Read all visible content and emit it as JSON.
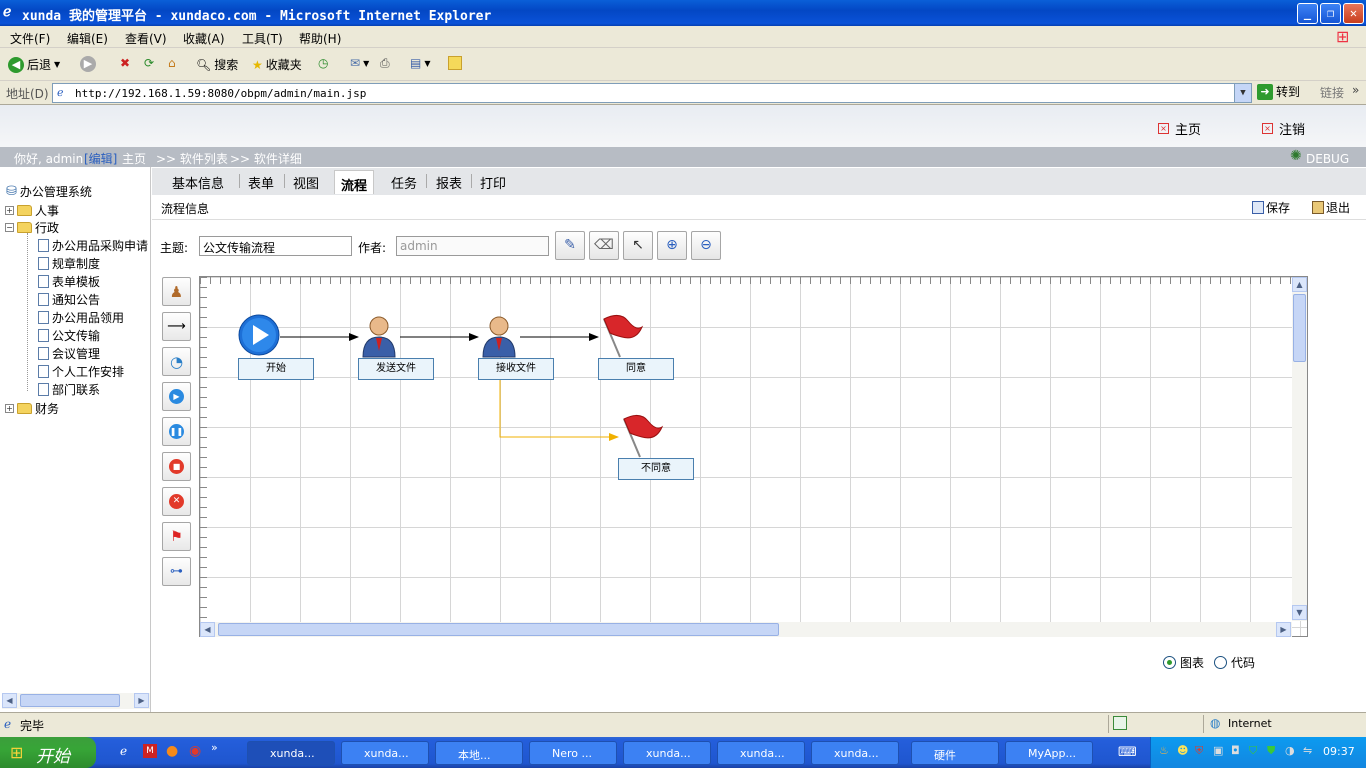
{
  "window": {
    "title": "xunda 我的管理平台 - xundaco.com - Microsoft Internet Explorer"
  },
  "menu": [
    "文件(F)",
    "编辑(E)",
    "查看(V)",
    "收藏(A)",
    "工具(T)",
    "帮助(H)"
  ],
  "toolbar": {
    "back": "后退",
    "search": "搜索",
    "favorites": "收藏夹"
  },
  "address": {
    "label": "地址(D)",
    "url": "http://192.168.1.59:8080/obpm/admin/main.jsp",
    "go": "转到",
    "links": "链接"
  },
  "header": {
    "home": "主页",
    "logout": "注销"
  },
  "nav": {
    "greeting": "你好, admin",
    "edit": "[编辑]",
    "home": "主页",
    "crumb1": ">> 软件列表",
    "crumb2": ">> 软件详细",
    "debug": "DEBUG"
  },
  "tree": {
    "root": "办公管理系统",
    "hr": "人事",
    "admin": "行政",
    "items": [
      "办公用品采购申请",
      "规章制度",
      "表单模板",
      "通知公告",
      "办公用品领用",
      "公文传输",
      "会议管理",
      "个人工作安排",
      "部门联系"
    ],
    "finance": "财务"
  },
  "tabs": [
    "基本信息",
    "表单",
    "视图",
    "流程",
    "任务",
    "报表",
    "打印"
  ],
  "info": {
    "title": "流程信息",
    "save": "保存",
    "exit": "退出"
  },
  "form": {
    "subject_label": "主题:",
    "subject": "公文传输流程",
    "author_label": "作者:",
    "author": "admin"
  },
  "nodes": {
    "start": "开始",
    "send": "发送文件",
    "receive": "接收文件",
    "agree": "同意",
    "disagree": "不同意"
  },
  "view": {
    "chart": "图表",
    "code": "代码",
    "selected": "图表"
  },
  "status": {
    "text": "完毕",
    "zone": "Internet"
  },
  "taskbar": {
    "start": "开始",
    "tasks": [
      "xunda...",
      "xunda...",
      "本地...",
      "Nero ...",
      "xunda...",
      "xunda...",
      "xunda...",
      "硬件",
      "MyApp..."
    ],
    "time": "09:37"
  }
}
